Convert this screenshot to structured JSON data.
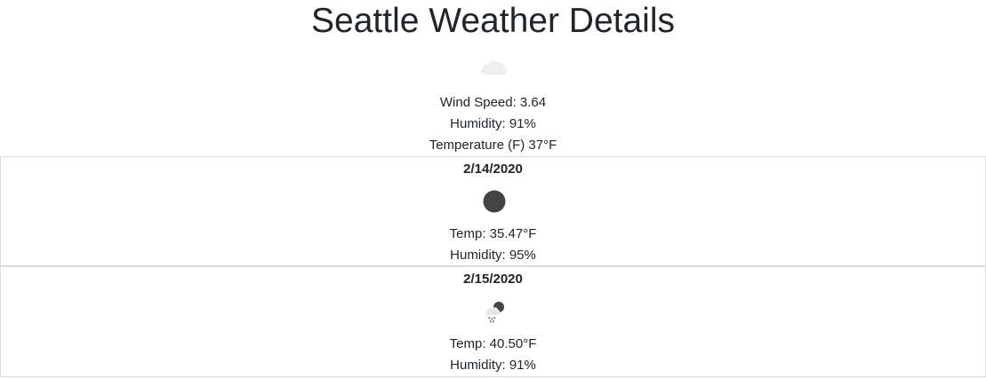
{
  "page": {
    "title": "Seattle Weather Details"
  },
  "current": {
    "icon": "cloud-icon",
    "wind_speed": "Wind Speed: 3.64",
    "humidity": "Humidity: 91%",
    "temperature": "Temperature (F) 37°F"
  },
  "forecast": [
    {
      "date": "2/14/2020",
      "icon": "moon-icon",
      "temp": "Temp: 35.47°F",
      "humidity": "Humidity: 95%"
    },
    {
      "date": "2/15/2020",
      "icon": "night-rain-icon",
      "temp": "Temp: 40.50°F",
      "humidity": "Humidity: 91%"
    }
  ],
  "colors": {
    "text": "#212529",
    "border": "#dcdcdc",
    "cloud": "#eeeeee",
    "moon": "#444444"
  }
}
